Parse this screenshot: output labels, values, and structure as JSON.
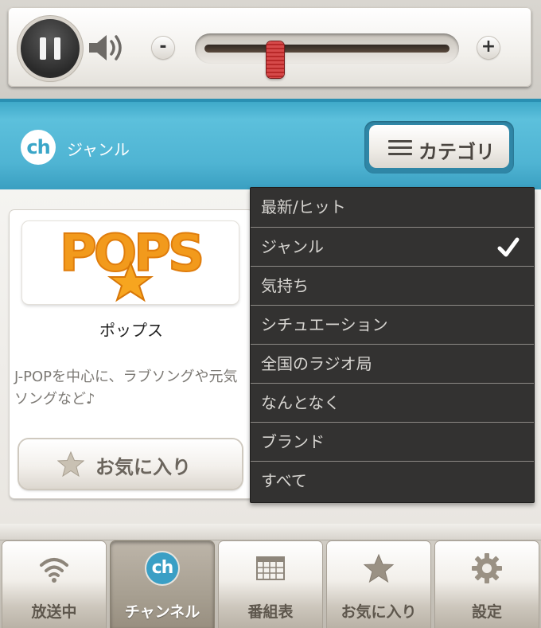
{
  "player": {
    "state": "playing",
    "volume_level": 0.29,
    "minus_label": "-",
    "plus_label": "+"
  },
  "header": {
    "logo_text": "ch",
    "section_label": "ジャンル",
    "category_button_label": "カテゴリ"
  },
  "genre_card": {
    "logo_text": "POPS",
    "name": "ポップス",
    "description": "J-POPを中心に、ラブソングや元気ソングなど♪",
    "favorite_button_label": "お気に入り"
  },
  "category_menu": {
    "items": [
      {
        "label": "最新/ヒット",
        "selected": false
      },
      {
        "label": "ジャンル",
        "selected": true
      },
      {
        "label": "気持ち",
        "selected": false
      },
      {
        "label": "シチュエーション",
        "selected": false
      },
      {
        "label": "全国のラジオ局",
        "selected": false
      },
      {
        "label": "なんとなく",
        "selected": false
      },
      {
        "label": "ブランド",
        "selected": false
      },
      {
        "label": "すべて",
        "selected": false
      }
    ]
  },
  "tabbar": {
    "tabs": [
      {
        "label": "放送中",
        "icon": "wifi-icon",
        "active": false
      },
      {
        "label": "チャンネル",
        "icon": "channel-icon",
        "active": true
      },
      {
        "label": "番組表",
        "icon": "grid-icon",
        "active": false
      },
      {
        "label": "お気に入り",
        "icon": "star-icon",
        "active": false
      },
      {
        "label": "設定",
        "icon": "gear-icon",
        "active": false
      }
    ],
    "channel_icon_text": "ch"
  },
  "colors": {
    "header_blue": "#4fb4d3",
    "menu_bg": "#333231",
    "pops_orange": "#f39a1d",
    "slider_red": "#c43030"
  }
}
